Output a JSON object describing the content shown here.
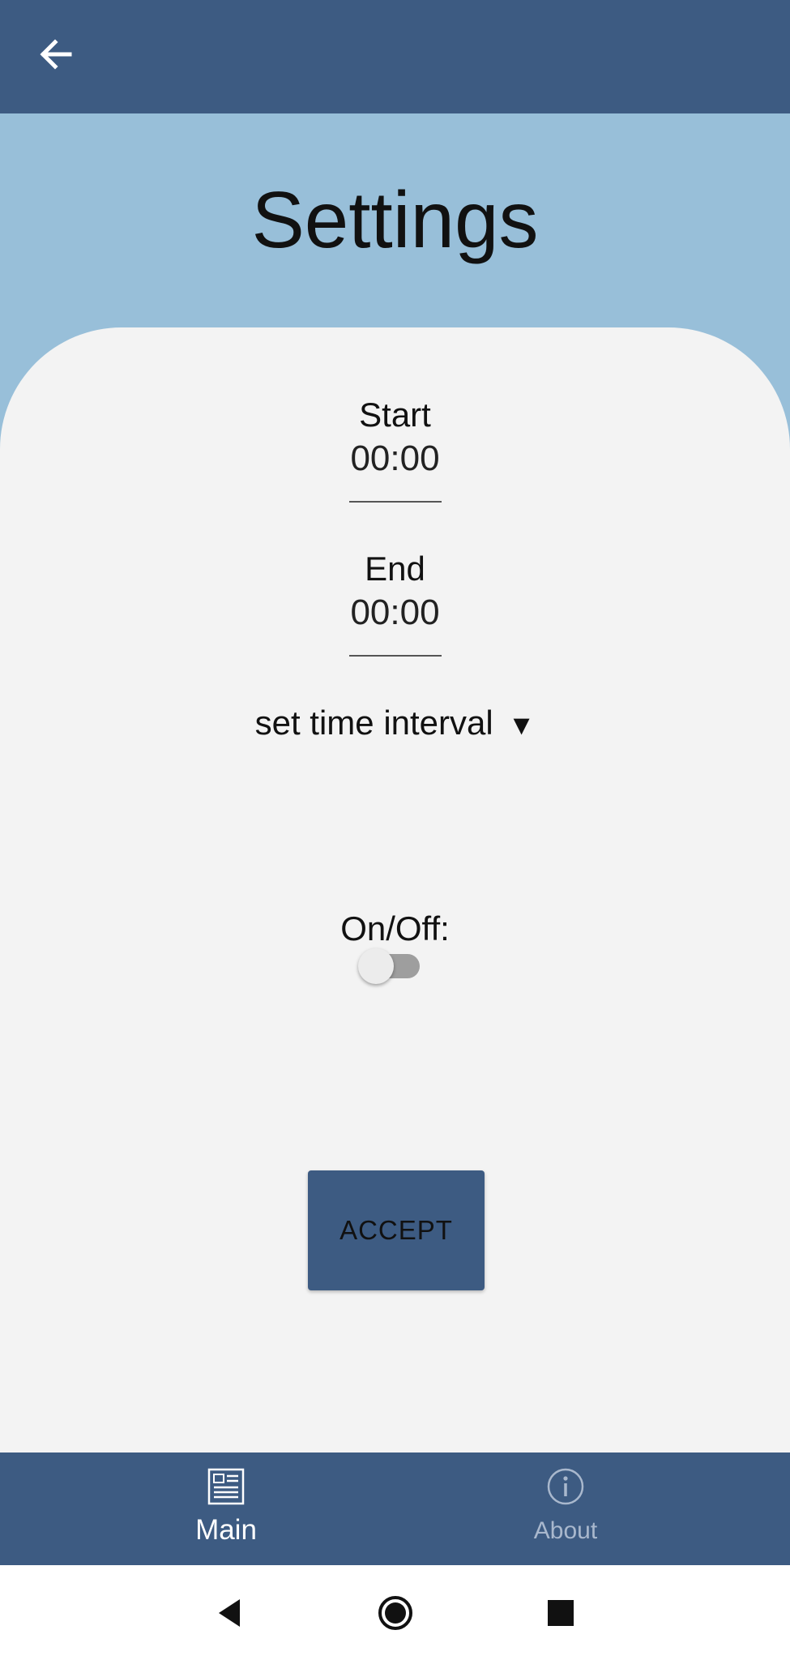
{
  "header": {
    "back_icon": "arrow-left-icon"
  },
  "page": {
    "title": "Settings"
  },
  "schedule": {
    "start_label": "Start",
    "start_value": "00:00",
    "end_label": "End",
    "end_value": "00:00",
    "interval_label": "set time interval",
    "interval_caret": "▼"
  },
  "toggle": {
    "label": "On/Off:",
    "state": "off"
  },
  "actions": {
    "accept_label": "ACCEPT"
  },
  "bottom_nav": {
    "items": [
      {
        "label": "Main",
        "icon": "newspaper-icon",
        "active": true
      },
      {
        "label": "About",
        "icon": "info-icon",
        "active": false
      }
    ]
  },
  "system_nav": {
    "back": "triangle-back-icon",
    "home": "circle-home-icon",
    "recents": "square-recents-icon"
  },
  "colors": {
    "app_bar": "#3d5b82",
    "hero": "#98bfd9",
    "card": "#f3f3f3",
    "button": "#3d5b82",
    "switch_track": "#9e9e9e",
    "switch_thumb": "#ececec"
  }
}
